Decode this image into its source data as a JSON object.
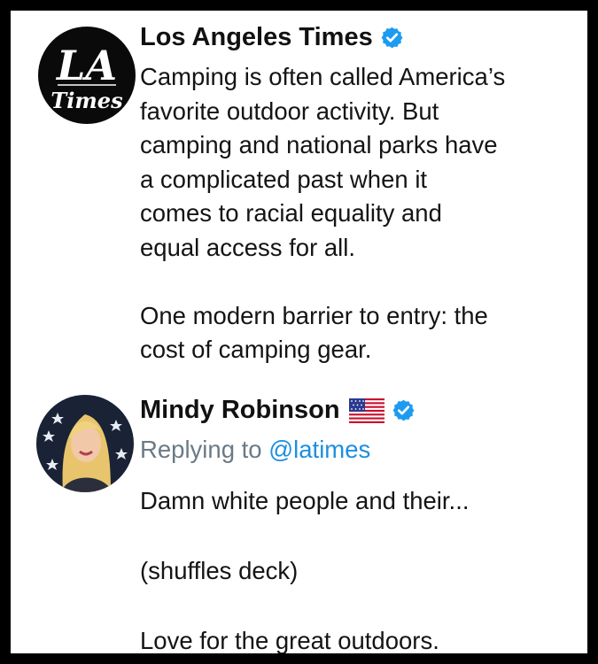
{
  "tweets": [
    {
      "author": "Los Angeles Times",
      "avatar_logo": "LA Times",
      "verified_icon": "verified-badge-icon",
      "text": "Camping is often called America’s\nfavorite outdoor activity. But\ncamping and national parks have\na complicated past when it\ncomes to racial equality and\nequal access for all.\n\nOne modern barrier to entry: the\ncost of camping gear."
    },
    {
      "author": "Mindy Robinson",
      "author_flag_icon": "us-flag-icon",
      "verified_icon": "verified-badge-icon",
      "replying_prefix": "Replying to",
      "replying_handle": "@latimes",
      "text": "Damn white people and their...\n\n(shuffles deck)\n\nLove for the great outdoors."
    }
  ],
  "colors": {
    "verified": "#1d9bf0",
    "link": "#1d8fe0",
    "muted": "#6b7a86",
    "frame": "#000000"
  }
}
